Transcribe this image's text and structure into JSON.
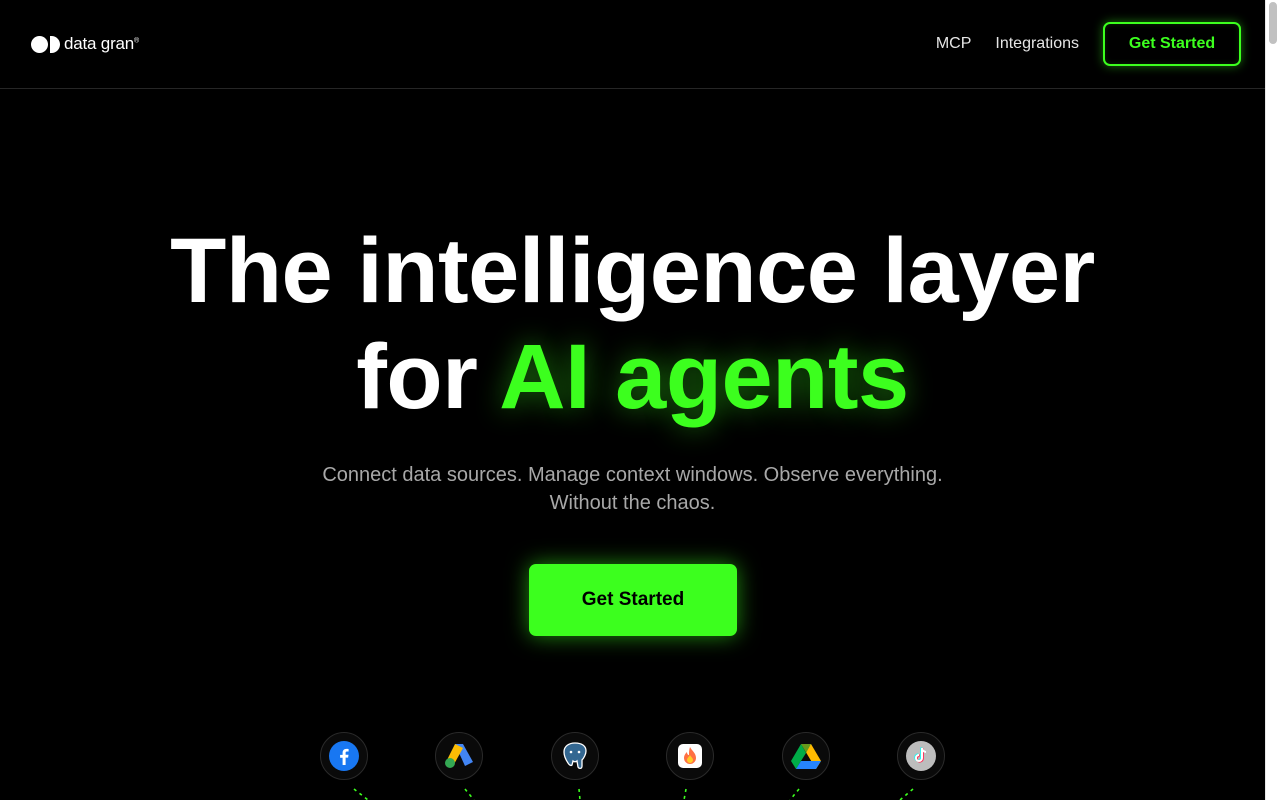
{
  "header": {
    "logo_text": "data gran",
    "logo_mark": "®",
    "nav": {
      "mcp_label": "MCP",
      "integrations_label": "Integrations",
      "cta_label": "Get Started"
    }
  },
  "hero": {
    "title_line1": "The intelligence layer",
    "title_line2_prefix": "for ",
    "title_line2_accent": "AI agents",
    "subtitle_line1": "Connect data sources. Manage context windows. Observe everything.",
    "subtitle_line2": "Without the chaos.",
    "cta_label": "Get Started"
  },
  "integrations": [
    {
      "icon": "facebook-icon"
    },
    {
      "icon": "google-ads-icon"
    },
    {
      "icon": "postgresql-icon"
    },
    {
      "icon": "firebase-icon"
    },
    {
      "icon": "google-drive-icon"
    },
    {
      "icon": "tiktok-icon"
    }
  ],
  "colors": {
    "background": "#000000",
    "accent": "#3cff1e",
    "subtitle": "#a8a8a8"
  }
}
